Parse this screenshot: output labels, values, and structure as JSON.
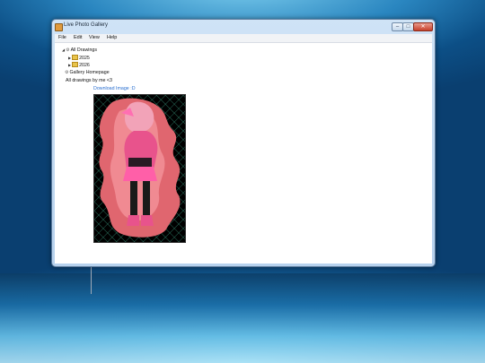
{
  "window": {
    "title": "Live Photo Gallery"
  },
  "menu": {
    "items": [
      "File",
      "Edit",
      "View",
      "Help"
    ]
  },
  "tree": {
    "root": "All Drawings",
    "children": [
      "2025",
      "2026"
    ],
    "homepage": "Gallery Homepage"
  },
  "main": {
    "caption": "All drawings by me <3",
    "download_link": "Download Image :D"
  },
  "colors": {
    "accent_link": "#2a6fd0",
    "drawing_background": "#000000",
    "drawing_pink": "#e8538c"
  },
  "icons": [
    "app-icon",
    "folder-icon",
    "gear-icon",
    "expand-arrow-icon"
  ]
}
